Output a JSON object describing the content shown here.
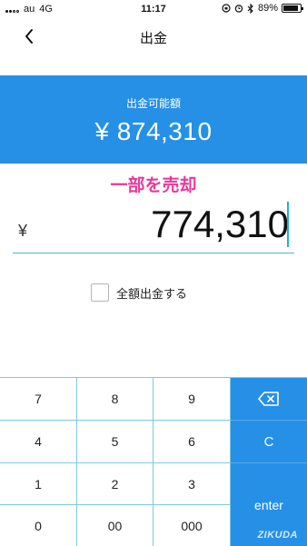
{
  "status_bar": {
    "carrier": "au",
    "network": "4G",
    "time": "11:17",
    "battery": "89%",
    "battery_level": 0.89
  },
  "nav": {
    "title": "出金",
    "back_icon": "chevron-left-icon"
  },
  "balance": {
    "label": "出金可能額",
    "amount": "¥ 874,310"
  },
  "annotation": "一部を売却",
  "amount_input": {
    "currency": "¥",
    "value": "774,310"
  },
  "full_withdraw": {
    "label": "全額出金する",
    "checked": false
  },
  "keypad": {
    "rows": [
      [
        "7",
        "8",
        "9"
      ],
      [
        "4",
        "5",
        "6"
      ],
      [
        "1",
        "2",
        "3"
      ],
      [
        "0",
        "00",
        "000"
      ]
    ],
    "backspace_icon": "backspace-icon",
    "clear_label": "C",
    "enter_label": "enter"
  },
  "watermark": "ZIKUDA",
  "colors": {
    "accent": "#2590e6",
    "annotation": "#e6399a",
    "caret": "#1fb0c8"
  }
}
